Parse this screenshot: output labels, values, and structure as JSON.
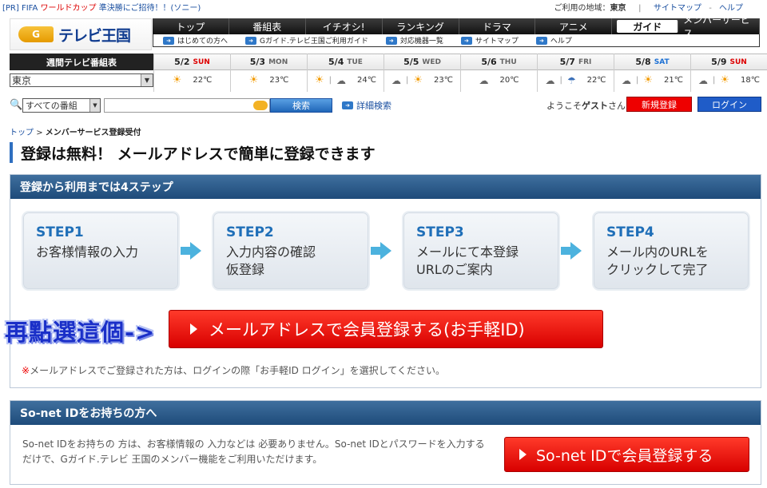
{
  "topbar": {
    "promo_pr": "[PR]",
    "promo_text1": "FIFA",
    "promo_hl": "ワールドカップ",
    "promo_text2": "準決勝にご招待！！(ソニー)",
    "location_label": "ご利用の地域：",
    "location_value": "東京",
    "sitemap": "サイトマップ",
    "sep": "-",
    "help": "ヘルプ"
  },
  "logo": {
    "g": "G",
    "text": "テレビ王国"
  },
  "nav": [
    "トップ",
    "番組表",
    "イチオシ!",
    "ランキング",
    "ドラマ",
    "アニメ",
    "ガイド",
    "メンバーサービス"
  ],
  "subnav": [
    "はじめての方へ",
    "Gガイド.テレビ王国ご利用ガイド",
    "対応機器一覧",
    "サイトマップ",
    "ヘルプ"
  ],
  "schedule": {
    "title": "週間テレビ番組表",
    "region": "東京",
    "days": [
      {
        "date": "5/2",
        "wd": "SUN",
        "type": "sun",
        "icons": [
          "sun"
        ],
        "temp": "22℃"
      },
      {
        "date": "5/3",
        "wd": "MON",
        "type": "",
        "icons": [
          "sun"
        ],
        "temp": "23℃"
      },
      {
        "date": "5/4",
        "wd": "TUE",
        "type": "",
        "icons": [
          "sun",
          "cloud"
        ],
        "temp": "24℃"
      },
      {
        "date": "5/5",
        "wd": "WED",
        "type": "",
        "icons": [
          "cloud",
          "sun"
        ],
        "temp": "23℃"
      },
      {
        "date": "5/6",
        "wd": "THU",
        "type": "",
        "icons": [
          "cloud"
        ],
        "temp": "20℃"
      },
      {
        "date": "5/7",
        "wd": "FRI",
        "type": "",
        "icons": [
          "cloud",
          "umbrella"
        ],
        "temp": "22℃"
      },
      {
        "date": "5/8",
        "wd": "SAT",
        "type": "sat",
        "icons": [
          "cloud",
          "sun"
        ],
        "temp": "21℃"
      },
      {
        "date": "5/9",
        "wd": "SUN",
        "type": "sun",
        "icons": [
          "cloud",
          "sun"
        ],
        "temp": "18℃"
      }
    ]
  },
  "search": {
    "scope": "すべての番組",
    "button": "検索",
    "advanced": "詳細検索"
  },
  "user": {
    "welcome_pre": "ようこそ",
    "welcome_name": "ゲスト",
    "welcome_post": "さん",
    "register": "新規登録",
    "login": "ログイン"
  },
  "breadcrumb": {
    "top": "トップ",
    "current": "メンバーサービス登録受付"
  },
  "page_title": "登録は無料！ メールアドレスで簡単に登録できます",
  "panel1": {
    "heading": "登録から利用までは4ステップ",
    "steps": [
      {
        "num": "STEP1",
        "line1": "お客様情報の入力",
        "line2": ""
      },
      {
        "num": "STEP2",
        "line1": "入力内容の確認",
        "line2": "仮登録"
      },
      {
        "num": "STEP3",
        "line1": "メールにて本登録",
        "line2": "URLのご案内"
      },
      {
        "num": "STEP4",
        "line1": "メール内のURLを",
        "line2": "クリックして完了"
      }
    ],
    "annotation": "再點選這個->",
    "mail_button": "メールアドレスで会員登録する(お手軽ID)",
    "note_ast": "※",
    "note": "メールアドレスでご登録された方は、ログインの際「お手軽ID ログイン」を選択してください。"
  },
  "panel2": {
    "heading": "So-net IDをお持ちの方へ",
    "text": "So-net IDをお持ちの 方は、お客様情報の 入力などは 必要ありません。So-net IDとパスワードを入力するだけで、Gガイド.テレビ 王国のメンバー機能をご利用いただけます。",
    "button": "So-net IDで会員登録する"
  }
}
